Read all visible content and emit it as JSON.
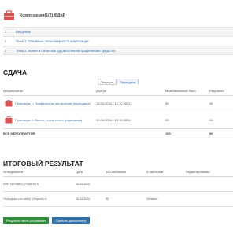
{
  "header": {
    "title": "Композиция(1/2).ФДиР",
    "icon": "course-icon",
    "icon_color": "#d9534f"
  },
  "outline": [
    {
      "num": "1",
      "label": "Введение"
    },
    {
      "num": "2",
      "label": "Тема 1. Основные закономерности композиции"
    },
    {
      "num": "3",
      "label": "Тема 2. Линия и пятно как художественно-графические средства"
    }
  ],
  "sdacha": {
    "title": "СДАЧА",
    "tabs": [
      {
        "label": "Текущие"
      },
      {
        "label": "Пересдача"
      }
    ],
    "columns": [
      "Мероприятие",
      "Доступ",
      "Максимальный балл",
      "Результат"
    ],
    "rows": [
      {
        "name": "Практикум 1. Графическое построение (пересдача)",
        "access": "12.04.2024 - 12.10.2024",
        "max": "50",
        "result": "45"
      },
      {
        "name": "Практикум 2. Линия, точка, пятно (пересдача)",
        "access": "12.04.2024 - 12.10.2024",
        "max": "50",
        "result": "45"
      }
    ],
    "total": {
      "label": "ВСЕ МЕРОПРИЯТИЯ",
      "max": "100",
      "result": "90"
    }
  },
  "itog": {
    "title": "ИТОГОВЫЙ РЕЗУЛЬТАТ",
    "columns": [
      "№ ведомости",
      "Дата",
      "100-балльная",
      "5-балльная",
      "Редактирование"
    ],
    "rows": [
      {
        "ved": "ФИИ (он-лайн) (Открыть) #",
        "date": "16.03.2024",
        "score100": "",
        "score5": "",
        "edit": ""
      },
      {
        "ved": "Пересдача (он-лайн) (Открыть) #",
        "date": "16.03.2024",
        "score100": "90",
        "score5": "Отлично",
        "edit": ""
      }
    ]
  },
  "buttons": {
    "claim": "Результат меня устраивает",
    "rate": "Оценить дисциплину"
  },
  "colors": {
    "link": "#3a6fa6",
    "green": "#2e8b3a",
    "blue": "#2f6ea8",
    "icon_red": "#d9534f"
  }
}
